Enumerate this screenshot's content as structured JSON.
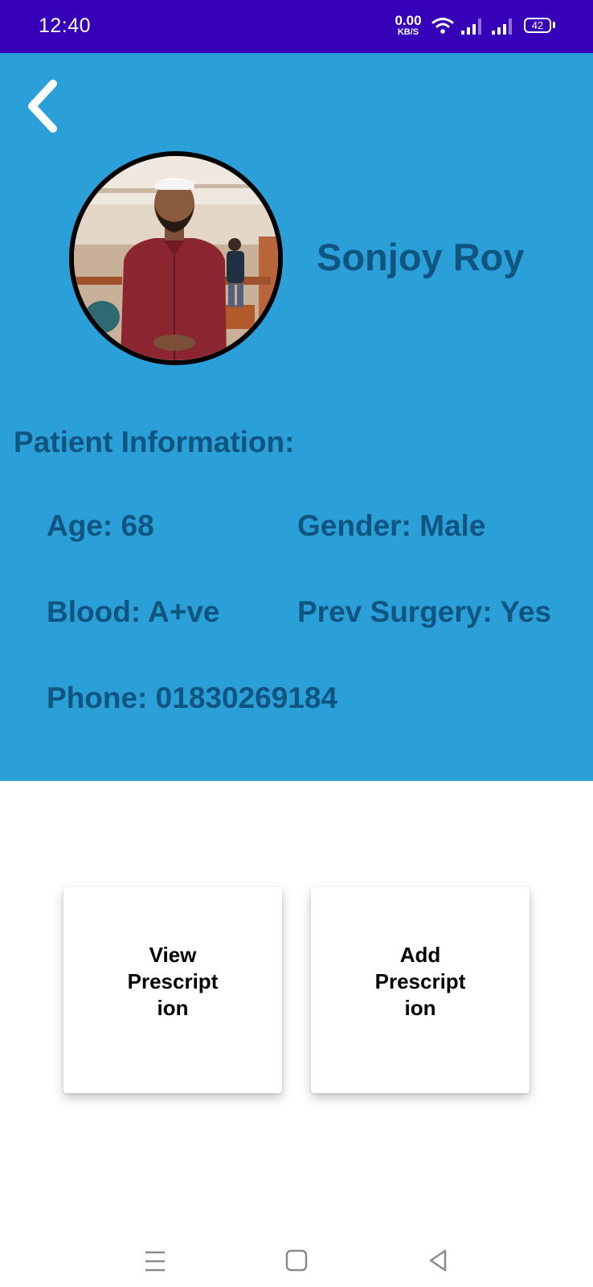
{
  "status_bar": {
    "time": "12:40",
    "net_speed_value": "0.00",
    "net_speed_unit": "KB/S",
    "battery": "42",
    "icons": [
      "wifi-icon",
      "signal-icon",
      "signal-icon",
      "battery-icon"
    ]
  },
  "header": {
    "back_icon": "chevron-left-icon"
  },
  "patient": {
    "name": "Sonjoy Roy",
    "section_title": "Patient Information:",
    "age": "Age: 68",
    "gender": "Gender: Male",
    "blood": "Blood: A+ve",
    "prev_surgery": "Prev Surgery: Yes",
    "phone": "Phone: 01830269184"
  },
  "actions": {
    "view_prescription_lines": [
      "View",
      "Prescript",
      "ion"
    ],
    "add_prescription_lines": [
      "Add",
      "Prescript",
      "ion"
    ]
  },
  "nav": {
    "icons": [
      "menu-icon",
      "home-square-icon",
      "back-triangle-icon"
    ]
  },
  "colors": {
    "status_bar": "#3500b8",
    "panel": "#2a9fd8",
    "text_accent": "#0f5580"
  }
}
